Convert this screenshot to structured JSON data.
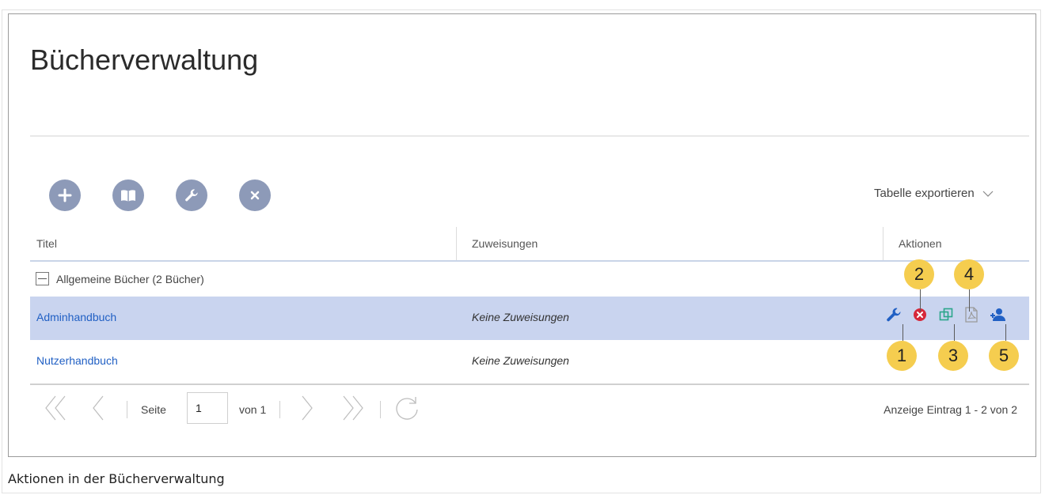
{
  "page": {
    "title": "Bücherverwaltung",
    "caption": "Aktionen in der Bücherverwaltung"
  },
  "toolbar": {
    "buttons": [
      {
        "icon": "plus-icon"
      },
      {
        "icon": "book-open-icon"
      },
      {
        "icon": "wrench-icon"
      },
      {
        "icon": "close-icon"
      }
    ],
    "export_label": "Tabelle exportieren"
  },
  "table": {
    "columns": [
      "Titel",
      "Zuweisungen",
      "Aktionen"
    ],
    "group": {
      "label": "Allgemeine Bücher (2 Bücher)"
    },
    "rows": [
      {
        "title": "Adminhandbuch",
        "assignments": "Keine Zuweisungen"
      },
      {
        "title": "Nutzerhandbuch",
        "assignments": "Keine Zuweisungen"
      }
    ],
    "row_actions": [
      "wrench-icon",
      "delete-icon",
      "copy-icon",
      "pdf-icon",
      "user-assign-icon"
    ]
  },
  "callouts": [
    "1",
    "2",
    "3",
    "4",
    "5"
  ],
  "pagination": {
    "page_label": "Seite",
    "page_value": "1",
    "of_label": "von 1",
    "summary": "Anzeige Eintrag 1 - 2 von 2"
  },
  "colors": {
    "accent": "#2160c4",
    "toolbar_button": "#8d9ab8",
    "selected_row": "#c9d4ef",
    "callout": "#f5cd4f",
    "delete_red": "#d6283a",
    "copy_green": "#2aa58a"
  }
}
